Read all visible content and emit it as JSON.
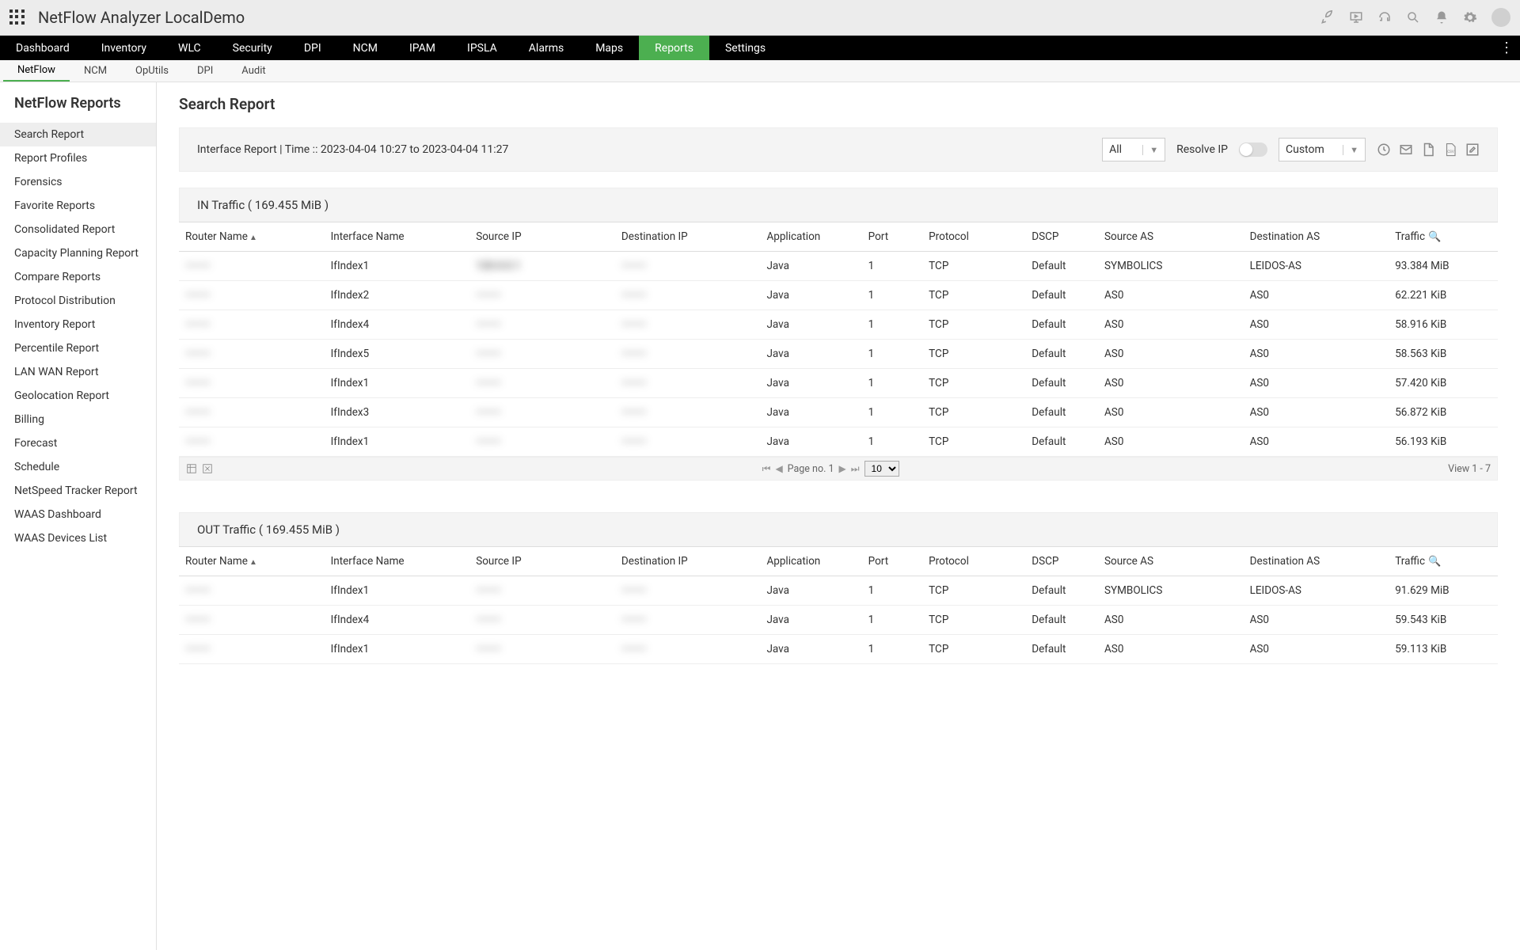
{
  "header": {
    "title": "NetFlow Analyzer LocalDemo"
  },
  "mainNav": {
    "items": [
      "Dashboard",
      "Inventory",
      "WLC",
      "Security",
      "DPI",
      "NCM",
      "IPAM",
      "IPSLA",
      "Alarms",
      "Maps",
      "Reports",
      "Settings"
    ],
    "active": "Reports"
  },
  "subNav": {
    "items": [
      "NetFlow",
      "NCM",
      "OpUtils",
      "DPI",
      "Audit"
    ],
    "active": "NetFlow"
  },
  "sidebar": {
    "title": "NetFlow Reports",
    "items": [
      "Search Report",
      "Report Profiles",
      "Forensics",
      "Favorite Reports",
      "Consolidated Report",
      "Capacity Planning Report",
      "Compare Reports",
      "Protocol Distribution",
      "Inventory Report",
      "Percentile Report",
      "LAN WAN Report",
      "Geolocation Report",
      "Billing",
      "Forecast",
      "Schedule",
      "NetSpeed Tracker Report",
      "WAAS Dashboard",
      "WAAS Devices List"
    ],
    "active": "Search Report"
  },
  "page": {
    "title": "Search Report",
    "filterInfo": "Interface Report | Time :: 2023-04-04 10:27 to 2023-04-04 11:27",
    "allSelect": "All",
    "resolveLabel": "Resolve IP",
    "customSelect": "Custom"
  },
  "columns": [
    "Router Name",
    "Interface Name",
    "Source IP",
    "Destination IP",
    "Application",
    "Port",
    "Protocol",
    "DSCP",
    "Source AS",
    "Destination AS",
    "Traffic"
  ],
  "inTraffic": {
    "header": "IN Traffic ( 169.455 MiB )",
    "rows": [
      {
        "router": "———",
        "iface": "IfIndex1",
        "sip": "120.0.0.1",
        "dip": "———",
        "app": "Java",
        "port": "1",
        "proto": "TCP",
        "dscp": "Default",
        "sas": "SYMBOLICS",
        "das": "LEIDOS-AS",
        "traffic": "93.384 MiB"
      },
      {
        "router": "———",
        "iface": "IfIndex2",
        "sip": "———",
        "dip": "———",
        "app": "Java",
        "port": "1",
        "proto": "TCP",
        "dscp": "Default",
        "sas": "AS0",
        "das": "AS0",
        "traffic": "62.221 KiB"
      },
      {
        "router": "———",
        "iface": "IfIndex4",
        "sip": "———",
        "dip": "———",
        "app": "Java",
        "port": "1",
        "proto": "TCP",
        "dscp": "Default",
        "sas": "AS0",
        "das": "AS0",
        "traffic": "58.916 KiB"
      },
      {
        "router": "———",
        "iface": "IfIndex5",
        "sip": "———",
        "dip": "———",
        "app": "Java",
        "port": "1",
        "proto": "TCP",
        "dscp": "Default",
        "sas": "AS0",
        "das": "AS0",
        "traffic": "58.563 KiB"
      },
      {
        "router": "———",
        "iface": "IfIndex1",
        "sip": "———",
        "dip": "———",
        "app": "Java",
        "port": "1",
        "proto": "TCP",
        "dscp": "Default",
        "sas": "AS0",
        "das": "AS0",
        "traffic": "57.420 KiB"
      },
      {
        "router": "———",
        "iface": "IfIndex3",
        "sip": "———",
        "dip": "———",
        "app": "Java",
        "port": "1",
        "proto": "TCP",
        "dscp": "Default",
        "sas": "AS0",
        "das": "AS0",
        "traffic": "56.872 KiB"
      },
      {
        "router": "———",
        "iface": "IfIndex1",
        "sip": "———",
        "dip": "———",
        "app": "Java",
        "port": "1",
        "proto": "TCP",
        "dscp": "Default",
        "sas": "AS0",
        "das": "AS0",
        "traffic": "56.193 KiB"
      }
    ],
    "footer": {
      "pageLabel": "Page no. 1",
      "perPage": "10",
      "viewRange": "View 1 - 7"
    }
  },
  "outTraffic": {
    "header": "OUT Traffic ( 169.455 MiB )",
    "rows": [
      {
        "router": "———",
        "iface": "IfIndex1",
        "sip": "———",
        "dip": "———",
        "app": "Java",
        "port": "1",
        "proto": "TCP",
        "dscp": "Default",
        "sas": "SYMBOLICS",
        "das": "LEIDOS-AS",
        "traffic": "91.629 MiB"
      },
      {
        "router": "———",
        "iface": "IfIndex4",
        "sip": "———",
        "dip": "———",
        "app": "Java",
        "port": "1",
        "proto": "TCP",
        "dscp": "Default",
        "sas": "AS0",
        "das": "AS0",
        "traffic": "59.543 KiB"
      },
      {
        "router": "———",
        "iface": "IfIndex1",
        "sip": "———",
        "dip": "———",
        "app": "Java",
        "port": "1",
        "proto": "TCP",
        "dscp": "Default",
        "sas": "AS0",
        "das": "AS0",
        "traffic": "59.113 KiB"
      }
    ]
  }
}
